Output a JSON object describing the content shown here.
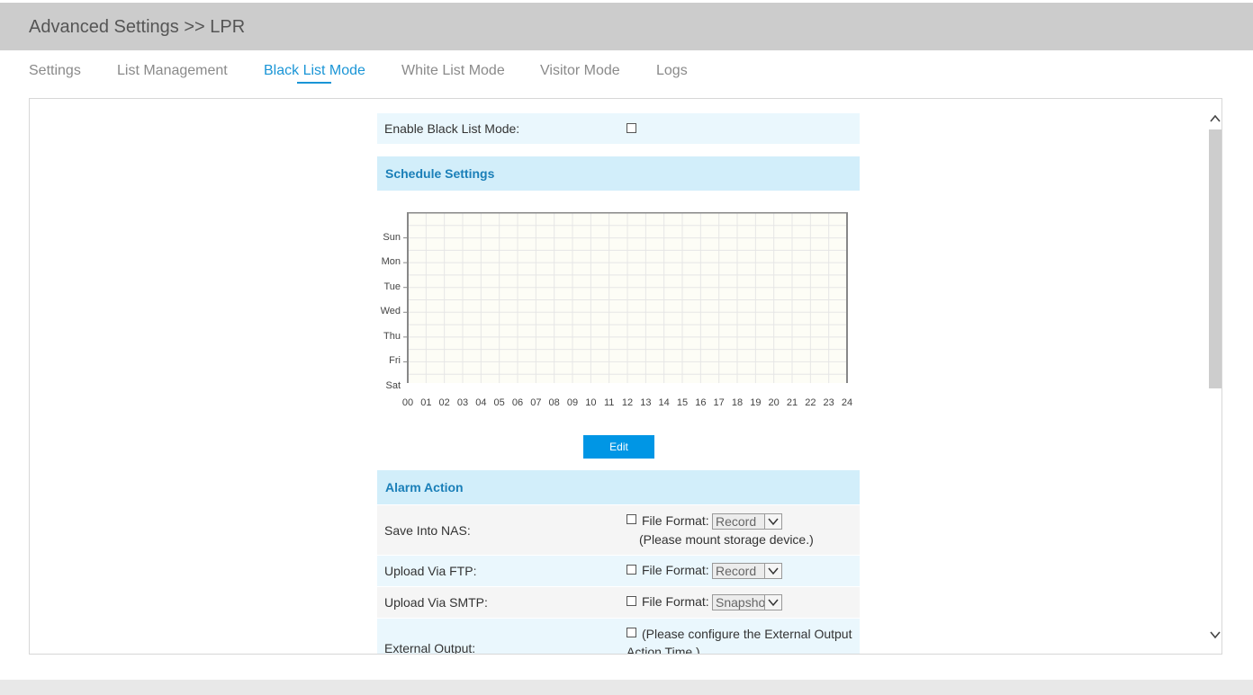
{
  "header": {
    "title": "Advanced Settings >> LPR"
  },
  "tabs": [
    {
      "label": "Settings"
    },
    {
      "label": "List Management"
    },
    {
      "label": "Black List Mode",
      "active": true
    },
    {
      "label": "White List Mode"
    },
    {
      "label": "Visitor Mode"
    },
    {
      "label": "Logs"
    }
  ],
  "enable": {
    "label": "Enable Black List Mode:",
    "checked": false
  },
  "schedule": {
    "title": "Schedule Settings",
    "days": [
      "Sun",
      "Mon",
      "Tue",
      "Wed",
      "Thu",
      "Fri",
      "Sat"
    ],
    "hours": [
      "00",
      "01",
      "02",
      "03",
      "04",
      "05",
      "06",
      "07",
      "08",
      "09",
      "10",
      "11",
      "12",
      "13",
      "14",
      "15",
      "16",
      "17",
      "18",
      "19",
      "20",
      "21",
      "22",
      "23",
      "24"
    ],
    "edit_label": "Edit"
  },
  "alarm": {
    "title": "Alarm Action",
    "nas": {
      "label": "Save Into NAS:",
      "ff_label": "File Format:",
      "value": "Record",
      "note": "(Please mount storage device.)"
    },
    "ftp": {
      "label": "Upload Via FTP:",
      "ff_label": "File Format:",
      "value": "Record"
    },
    "smtp": {
      "label": "Upload Via SMTP:",
      "ff_label": "File Format:",
      "value": "Snapsho"
    },
    "ext": {
      "label": "External Output:",
      "note1": "(Please configure the External Output",
      "note2": "Action Time.)"
    }
  },
  "colors": {
    "accent": "#1a95d6",
    "button": "#0096e5",
    "row_bg": "#eaf7fd",
    "section_bg": "#d2eefa"
  },
  "icons": {
    "scroll_up": "chevron-up-icon",
    "scroll_down": "chevron-down-icon",
    "select_arrow": "chevron-down-icon"
  }
}
